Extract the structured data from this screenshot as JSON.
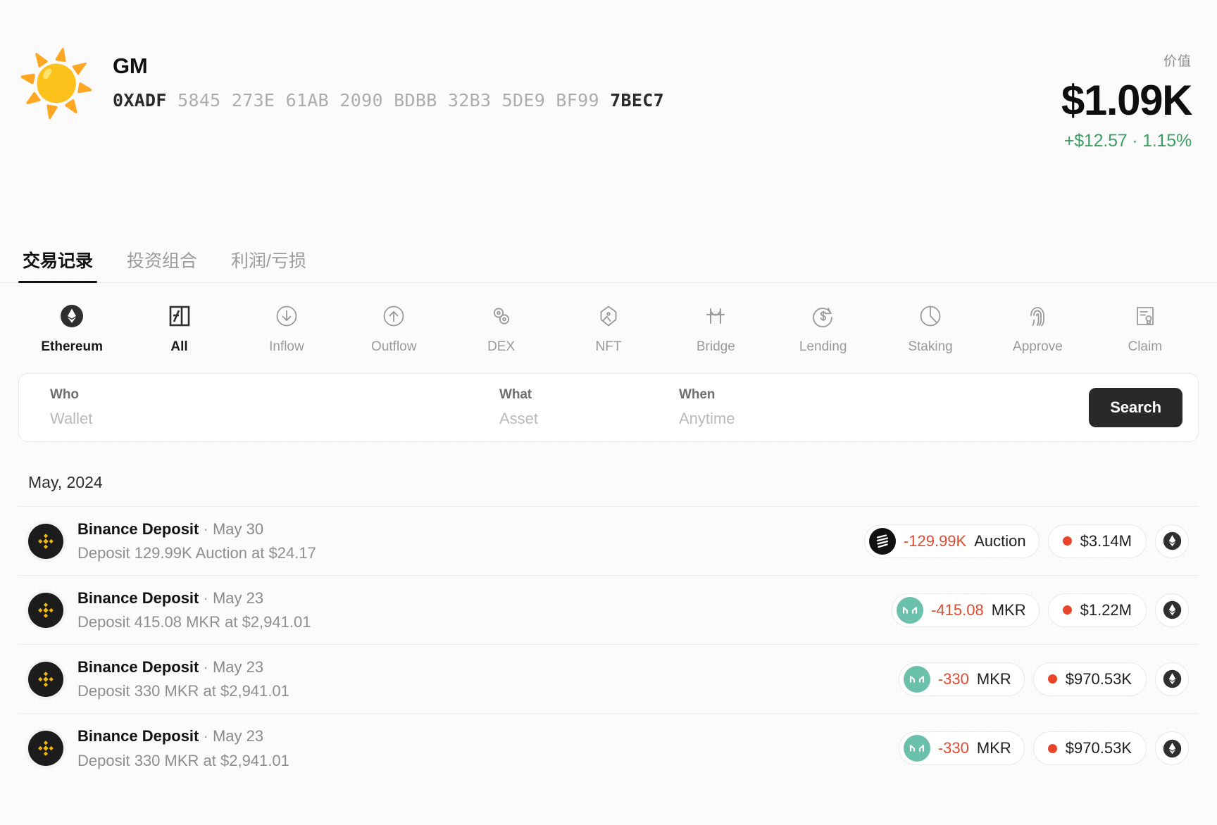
{
  "header": {
    "avatar_icon": "sun-emoji",
    "name": "GM",
    "address_lead": "0XADF",
    "address_mid": " 5845 273E 61AB 2090 BDBB 32B3 5DE9 BF99 ",
    "address_tail": "7BEC7",
    "value_label": "价值",
    "value_amount": "$1.09K",
    "value_change": "+$12.57 · 1.15%",
    "change_color": "#3f9e63"
  },
  "tabs": [
    {
      "label": "交易记录",
      "active": true
    },
    {
      "label": "投资组合",
      "active": false
    },
    {
      "label": "利润/亏损",
      "active": false
    }
  ],
  "filters": [
    {
      "label": "Ethereum",
      "icon": "ethereum-icon",
      "active": true
    },
    {
      "label": "All",
      "icon": "all-icon",
      "active": true
    },
    {
      "label": "Inflow",
      "icon": "arrow-down-circle-icon",
      "active": false
    },
    {
      "label": "Outflow",
      "icon": "arrow-up-circle-icon",
      "active": false
    },
    {
      "label": "DEX",
      "icon": "dex-swap-icon",
      "active": false
    },
    {
      "label": "NFT",
      "icon": "nft-image-icon",
      "active": false
    },
    {
      "label": "Bridge",
      "icon": "bridge-icon",
      "active": false
    },
    {
      "label": "Lending",
      "icon": "lending-dollar-icon",
      "active": false
    },
    {
      "label": "Staking",
      "icon": "staking-pie-icon",
      "active": false
    },
    {
      "label": "Approve",
      "icon": "fingerprint-icon",
      "active": false
    },
    {
      "label": "Claim",
      "icon": "certificate-icon",
      "active": false
    }
  ],
  "search": {
    "who_label": "Who",
    "who_placeholder": "Wallet",
    "what_label": "What",
    "what_placeholder": "Asset",
    "when_label": "When",
    "when_placeholder": "Anytime",
    "button_label": "Search"
  },
  "transactions": {
    "month": "May, 2024",
    "rows": [
      {
        "logo": "binance-icon",
        "title": "Binance Deposit",
        "sep": "·",
        "date": "May 30",
        "subtitle": "Deposit 129.99K Auction at $24.17",
        "amount": "-129.99K",
        "symbol": "Auction",
        "token_icon": "auction-token-icon",
        "token_color": "#111111",
        "usd": "$3.14M",
        "chain_icon": "ethereum-icon"
      },
      {
        "logo": "binance-icon",
        "title": "Binance Deposit",
        "sep": "·",
        "date": "May 23",
        "subtitle": "Deposit 415.08 MKR at $2,941.01",
        "amount": "-415.08",
        "symbol": "MKR",
        "token_icon": "maker-token-icon",
        "token_color": "#6ac0ab",
        "usd": "$1.22M",
        "chain_icon": "ethereum-icon"
      },
      {
        "logo": "binance-icon",
        "title": "Binance Deposit",
        "sep": "·",
        "date": "May 23",
        "subtitle": "Deposit 330 MKR at $2,941.01",
        "amount": "-330",
        "symbol": "MKR",
        "token_icon": "maker-token-icon",
        "token_color": "#6ac0ab",
        "usd": "$970.53K",
        "chain_icon": "ethereum-icon"
      },
      {
        "logo": "binance-icon",
        "title": "Binance Deposit",
        "sep": "·",
        "date": "May 23",
        "subtitle": "Deposit 330 MKR at $2,941.01",
        "amount": "-330",
        "symbol": "MKR",
        "token_icon": "maker-token-icon",
        "token_color": "#6ac0ab",
        "usd": "$970.53K",
        "chain_icon": "ethereum-icon"
      }
    ]
  }
}
